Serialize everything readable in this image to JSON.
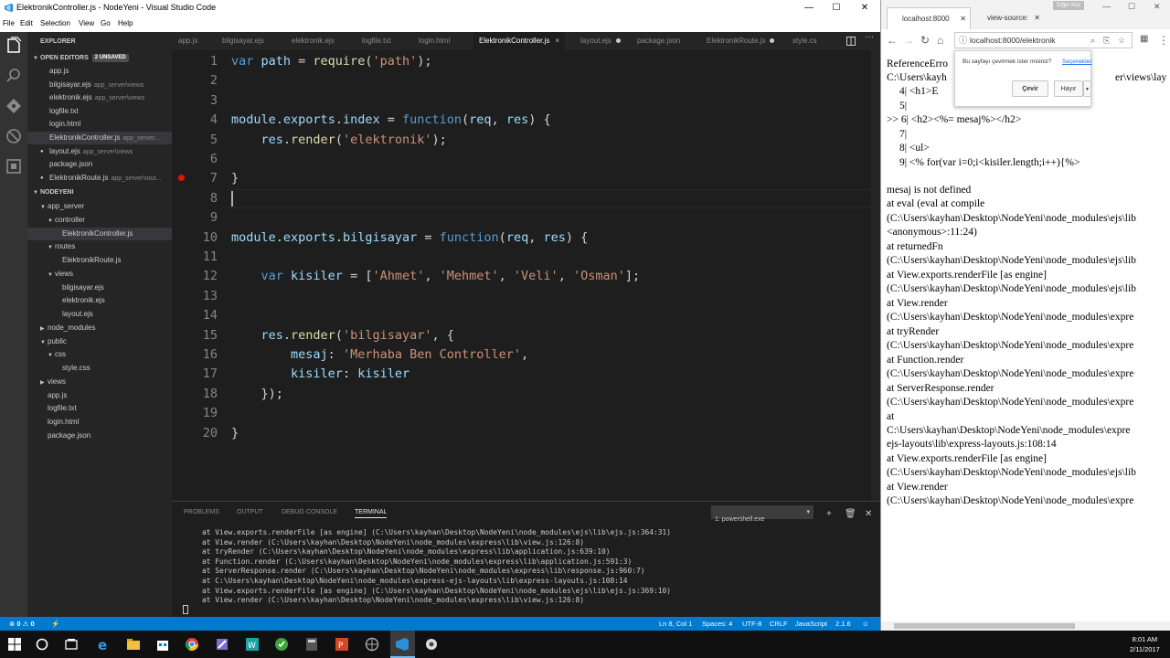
{
  "vscode": {
    "window_title": "ElektronikController.js - NodeYeni - Visual Studio Code",
    "menu": [
      "File",
      "Edit",
      "Selection",
      "View",
      "Go",
      "Help"
    ],
    "explorer": {
      "header": "EXPLORER",
      "open_editors_label": "OPEN EDITORS",
      "unsaved_badge": "2 UNSAVED",
      "open_editors": [
        {
          "name": "app.js",
          "path": ""
        },
        {
          "name": "bilgisayar.ejs",
          "path": "app_server\\views"
        },
        {
          "name": "elektronik.ejs",
          "path": "app_server\\views"
        },
        {
          "name": "logfile.txt",
          "path": ""
        },
        {
          "name": "login.html",
          "path": ""
        },
        {
          "name": "ElektronikController.js",
          "path": "app_server..."
        },
        {
          "name": "layout.ejs",
          "path": "app_server\\views"
        },
        {
          "name": "package.json",
          "path": ""
        },
        {
          "name": "ElektronikRoute.js",
          "path": "app_server\\rout..."
        }
      ],
      "project_label": "NODEYENI",
      "tree": [
        {
          "name": "app_server",
          "indent": 1,
          "arrow": "▼"
        },
        {
          "name": "controller",
          "indent": 2,
          "arrow": "▼"
        },
        {
          "name": "ElektronikController.js",
          "indent": 3,
          "arrow": ""
        },
        {
          "name": "routes",
          "indent": 2,
          "arrow": "▼"
        },
        {
          "name": "ElektronikRoute.js",
          "indent": 3,
          "arrow": ""
        },
        {
          "name": "views",
          "indent": 2,
          "arrow": "▼"
        },
        {
          "name": "bilgisayar.ejs",
          "indent": 3,
          "arrow": ""
        },
        {
          "name": "elektronik.ejs",
          "indent": 3,
          "arrow": ""
        },
        {
          "name": "layout.ejs",
          "indent": 3,
          "arrow": ""
        },
        {
          "name": "node_modules",
          "indent": 1,
          "arrow": "▶"
        },
        {
          "name": "public",
          "indent": 1,
          "arrow": "▼"
        },
        {
          "name": "css",
          "indent": 2,
          "arrow": "▼"
        },
        {
          "name": "style.css",
          "indent": 3,
          "arrow": ""
        },
        {
          "name": "views",
          "indent": 1,
          "arrow": "▶"
        },
        {
          "name": "app.js",
          "indent": 1,
          "arrow": ""
        },
        {
          "name": "logfile.txt",
          "indent": 1,
          "arrow": ""
        },
        {
          "name": "login.html",
          "indent": 1,
          "arrow": ""
        },
        {
          "name": "package.json",
          "indent": 1,
          "arrow": ""
        }
      ]
    },
    "tabs": [
      {
        "label": "app.js",
        "dirty": false
      },
      {
        "label": "bilgisayar.ejs",
        "dirty": false
      },
      {
        "label": "elektronik.ejs",
        "dirty": false
      },
      {
        "label": "logfile.txt",
        "dirty": false
      },
      {
        "label": "login.html",
        "dirty": false
      },
      {
        "label": "ElektronikController.js",
        "dirty": false
      },
      {
        "label": "layout.ejs",
        "dirty": true
      },
      {
        "label": "package.json",
        "dirty": false
      },
      {
        "label": "ElektronikRoute.js",
        "dirty": true
      },
      {
        "label": "style.cs",
        "dirty": false
      }
    ],
    "active_tab_close": "×",
    "code_lines": [
      {
        "n": "1",
        "tokens": [
          [
            "k",
            "var "
          ],
          [
            "v",
            "path"
          ],
          [
            "p",
            " = "
          ],
          [
            "f",
            "require"
          ],
          [
            "p",
            "("
          ],
          [
            "s",
            "'path'"
          ],
          [
            "p",
            ");"
          ]
        ]
      },
      {
        "n": "2",
        "tokens": []
      },
      {
        "n": "3",
        "tokens": []
      },
      {
        "n": "4",
        "tokens": [
          [
            "v",
            "module"
          ],
          [
            "p",
            "."
          ],
          [
            "v",
            "exports"
          ],
          [
            "p",
            "."
          ],
          [
            "v",
            "index"
          ],
          [
            "p",
            " = "
          ],
          [
            "k",
            "function"
          ],
          [
            "p",
            "("
          ],
          [
            "v",
            "req"
          ],
          [
            "p",
            ", "
          ],
          [
            "v",
            "res"
          ],
          [
            "p",
            ") {"
          ]
        ]
      },
      {
        "n": "5",
        "tokens": [
          [
            "p",
            "    "
          ],
          [
            "v",
            "res"
          ],
          [
            "p",
            "."
          ],
          [
            "f",
            "render"
          ],
          [
            "p",
            "("
          ],
          [
            "s",
            "'elektronik'"
          ],
          [
            "p",
            ");"
          ]
        ]
      },
      {
        "n": "6",
        "tokens": []
      },
      {
        "n": "7",
        "tokens": [
          [
            "p",
            "}"
          ]
        ]
      },
      {
        "n": "8",
        "tokens": []
      },
      {
        "n": "9",
        "tokens": []
      },
      {
        "n": "10",
        "tokens": [
          [
            "v",
            "module"
          ],
          [
            "p",
            "."
          ],
          [
            "v",
            "exports"
          ],
          [
            "p",
            "."
          ],
          [
            "v",
            "bilgisayar"
          ],
          [
            "p",
            " = "
          ],
          [
            "k",
            "function"
          ],
          [
            "p",
            "("
          ],
          [
            "v",
            "req"
          ],
          [
            "p",
            ", "
          ],
          [
            "v",
            "res"
          ],
          [
            "p",
            ") {"
          ]
        ]
      },
      {
        "n": "11",
        "tokens": []
      },
      {
        "n": "12",
        "tokens": [
          [
            "p",
            "    "
          ],
          [
            "k",
            "var "
          ],
          [
            "v",
            "kisiler"
          ],
          [
            "p",
            " = ["
          ],
          [
            "s",
            "'Ahmet'"
          ],
          [
            "p",
            ", "
          ],
          [
            "s",
            "'Mehmet'"
          ],
          [
            "p",
            ", "
          ],
          [
            "s",
            "'Veli'"
          ],
          [
            "p",
            ", "
          ],
          [
            "s",
            "'Osman'"
          ],
          [
            "p",
            "];"
          ]
        ]
      },
      {
        "n": "13",
        "tokens": []
      },
      {
        "n": "14",
        "tokens": []
      },
      {
        "n": "15",
        "tokens": [
          [
            "p",
            "    "
          ],
          [
            "v",
            "res"
          ],
          [
            "p",
            "."
          ],
          [
            "f",
            "render"
          ],
          [
            "p",
            "("
          ],
          [
            "s",
            "'bilgisayar'"
          ],
          [
            "p",
            ", {"
          ]
        ]
      },
      {
        "n": "16",
        "tokens": [
          [
            "p",
            "        "
          ],
          [
            "v",
            "mesaj"
          ],
          [
            "p",
            ": "
          ],
          [
            "s",
            "'Merhaba Ben Controller'"
          ],
          [
            "p",
            ","
          ]
        ]
      },
      {
        "n": "17",
        "tokens": [
          [
            "p",
            "        "
          ],
          [
            "v",
            "kisiler"
          ],
          [
            "p",
            ": "
          ],
          [
            "v",
            "kisiler"
          ]
        ]
      },
      {
        "n": "18",
        "tokens": [
          [
            "p",
            "    });"
          ]
        ]
      },
      {
        "n": "19",
        "tokens": []
      },
      {
        "n": "20",
        "tokens": [
          [
            "p",
            "}"
          ]
        ]
      }
    ],
    "panel": {
      "tabs": [
        "PROBLEMS",
        "OUTPUT",
        "DEBUG CONSOLE",
        "TERMINAL"
      ],
      "active_tab": "TERMINAL",
      "terminal_select": "1: powershell.exe",
      "terminal_lines": [
        "at View.exports.renderFile [as engine] (C:\\Users\\kayhan\\Desktop\\NodeYeni\\node_modules\\ejs\\lib\\ejs.js:364:31)",
        "at View.render (C:\\Users\\kayhan\\Desktop\\NodeYeni\\node_modules\\express\\lib\\view.js:126:8)",
        "at tryRender (C:\\Users\\kayhan\\Desktop\\NodeYeni\\node_modules\\express\\lib\\application.js:639:10)",
        "at Function.render (C:\\Users\\kayhan\\Desktop\\NodeYeni\\node_modules\\express\\lib\\application.js:591:3)",
        "at ServerResponse.render (C:\\Users\\kayhan\\Desktop\\NodeYeni\\node_modules\\express\\lib\\response.js:960:7)",
        "at C:\\Users\\kayhan\\Desktop\\NodeYeni\\node_modules\\express-ejs-layouts\\lib\\express-layouts.js:108:14",
        "at View.exports.renderFile [as engine] (C:\\Users\\kayhan\\Desktop\\NodeYeni\\node_modules\\ejs\\lib\\ejs.js:369:10)",
        "at View.render (C:\\Users\\kayhan\\Desktop\\NodeYeni\\node_modules\\express\\lib\\view.js:126:8)"
      ]
    },
    "status": {
      "errors": "0",
      "warnings": "0",
      "position": "Ln 8, Col 1",
      "spaces": "Spaces: 4",
      "encoding": "UTF-8",
      "eol": "CRLF",
      "language": "JavaScript",
      "version": "2.1.6",
      "accent": "#007acc"
    }
  },
  "chrome": {
    "profile_label": "Diğer Kişi",
    "tabs": [
      {
        "label": "localhost:8000"
      },
      {
        "label": "view-source:"
      }
    ],
    "url": "localhost:8000/elektronik",
    "translate_popup": {
      "question": "Bu sayfayı çevirmek ister misiniz?",
      "options_link": "Seçenekler",
      "translate_button": "Çevir",
      "decline_button": "Hayır"
    },
    "page_lines": [
      "ReferenceErro",
      "C:\\Users\\kayh",
      "4|    <h1>E",
      "5|",
      ">> 6|    <h2><%= mesaj%></h2>",
      "7|",
      "8|    <ul>",
      "9|    <% for(var i=0;i<kisiler.length;i++){%>",
      "",
      "mesaj is not defined",
      "   at eval (eval at compile",
      "(C:\\Users\\kayhan\\Desktop\\NodeYeni\\node_modules\\ejs\\lib",
      "<anonymous>:11:24)",
      "   at returnedFn",
      "(C:\\Users\\kayhan\\Desktop\\NodeYeni\\node_modules\\ejs\\lib",
      "   at View.exports.renderFile [as engine]",
      "(C:\\Users\\kayhan\\Desktop\\NodeYeni\\node_modules\\ejs\\lib",
      "   at View.render",
      "(C:\\Users\\kayhan\\Desktop\\NodeYeni\\node_modules\\expre",
      "   at tryRender",
      "(C:\\Users\\kayhan\\Desktop\\NodeYeni\\node_modules\\expre",
      "   at Function.render",
      "(C:\\Users\\kayhan\\Desktop\\NodeYeni\\node_modules\\expre",
      "   at ServerResponse.render",
      "(C:\\Users\\kayhan\\Desktop\\NodeYeni\\node_modules\\expre",
      "   at",
      "C:\\Users\\kayhan\\Desktop\\NodeYeni\\node_modules\\expre",
      "ejs-layouts\\lib\\express-layouts.js:108:14",
      "   at View.exports.renderFile [as engine]",
      "(C:\\Users\\kayhan\\Desktop\\NodeYeni\\node_modules\\ejs\\lib",
      "   at View.render",
      "(C:\\Users\\kayhan\\Desktop\\NodeYeni\\node_modules\\expre"
    ],
    "page_line2_tail": "er\\views\\lay"
  },
  "taskbar": {
    "time": "8:01 AM",
    "date": "2/11/2017"
  }
}
